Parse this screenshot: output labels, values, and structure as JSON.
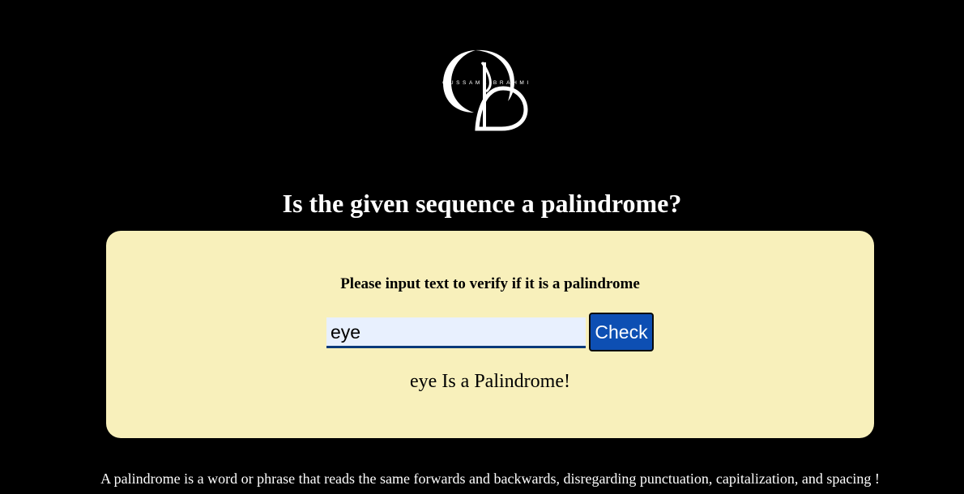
{
  "logo": {
    "text": "OUSSAMA BRAHMI",
    "icon": "ob-monogram-logo"
  },
  "title": "Is the given sequence a palindrome?",
  "card": {
    "prompt": "Please input text to verify if it is a palindrome",
    "input_value": "eye",
    "check_label": "Check",
    "result": "eye Is a Palindrome!"
  },
  "footer": {
    "note": "A palindrome is a word or phrase that reads the same forwards and backwards, disregarding punctuation, capitalization, and spacing !"
  },
  "colors": {
    "background": "#000000",
    "card": "#f8f0bb",
    "button": "#0d4fb3",
    "input_bg": "#e8f0fe",
    "input_border": "#0a3a7a"
  }
}
